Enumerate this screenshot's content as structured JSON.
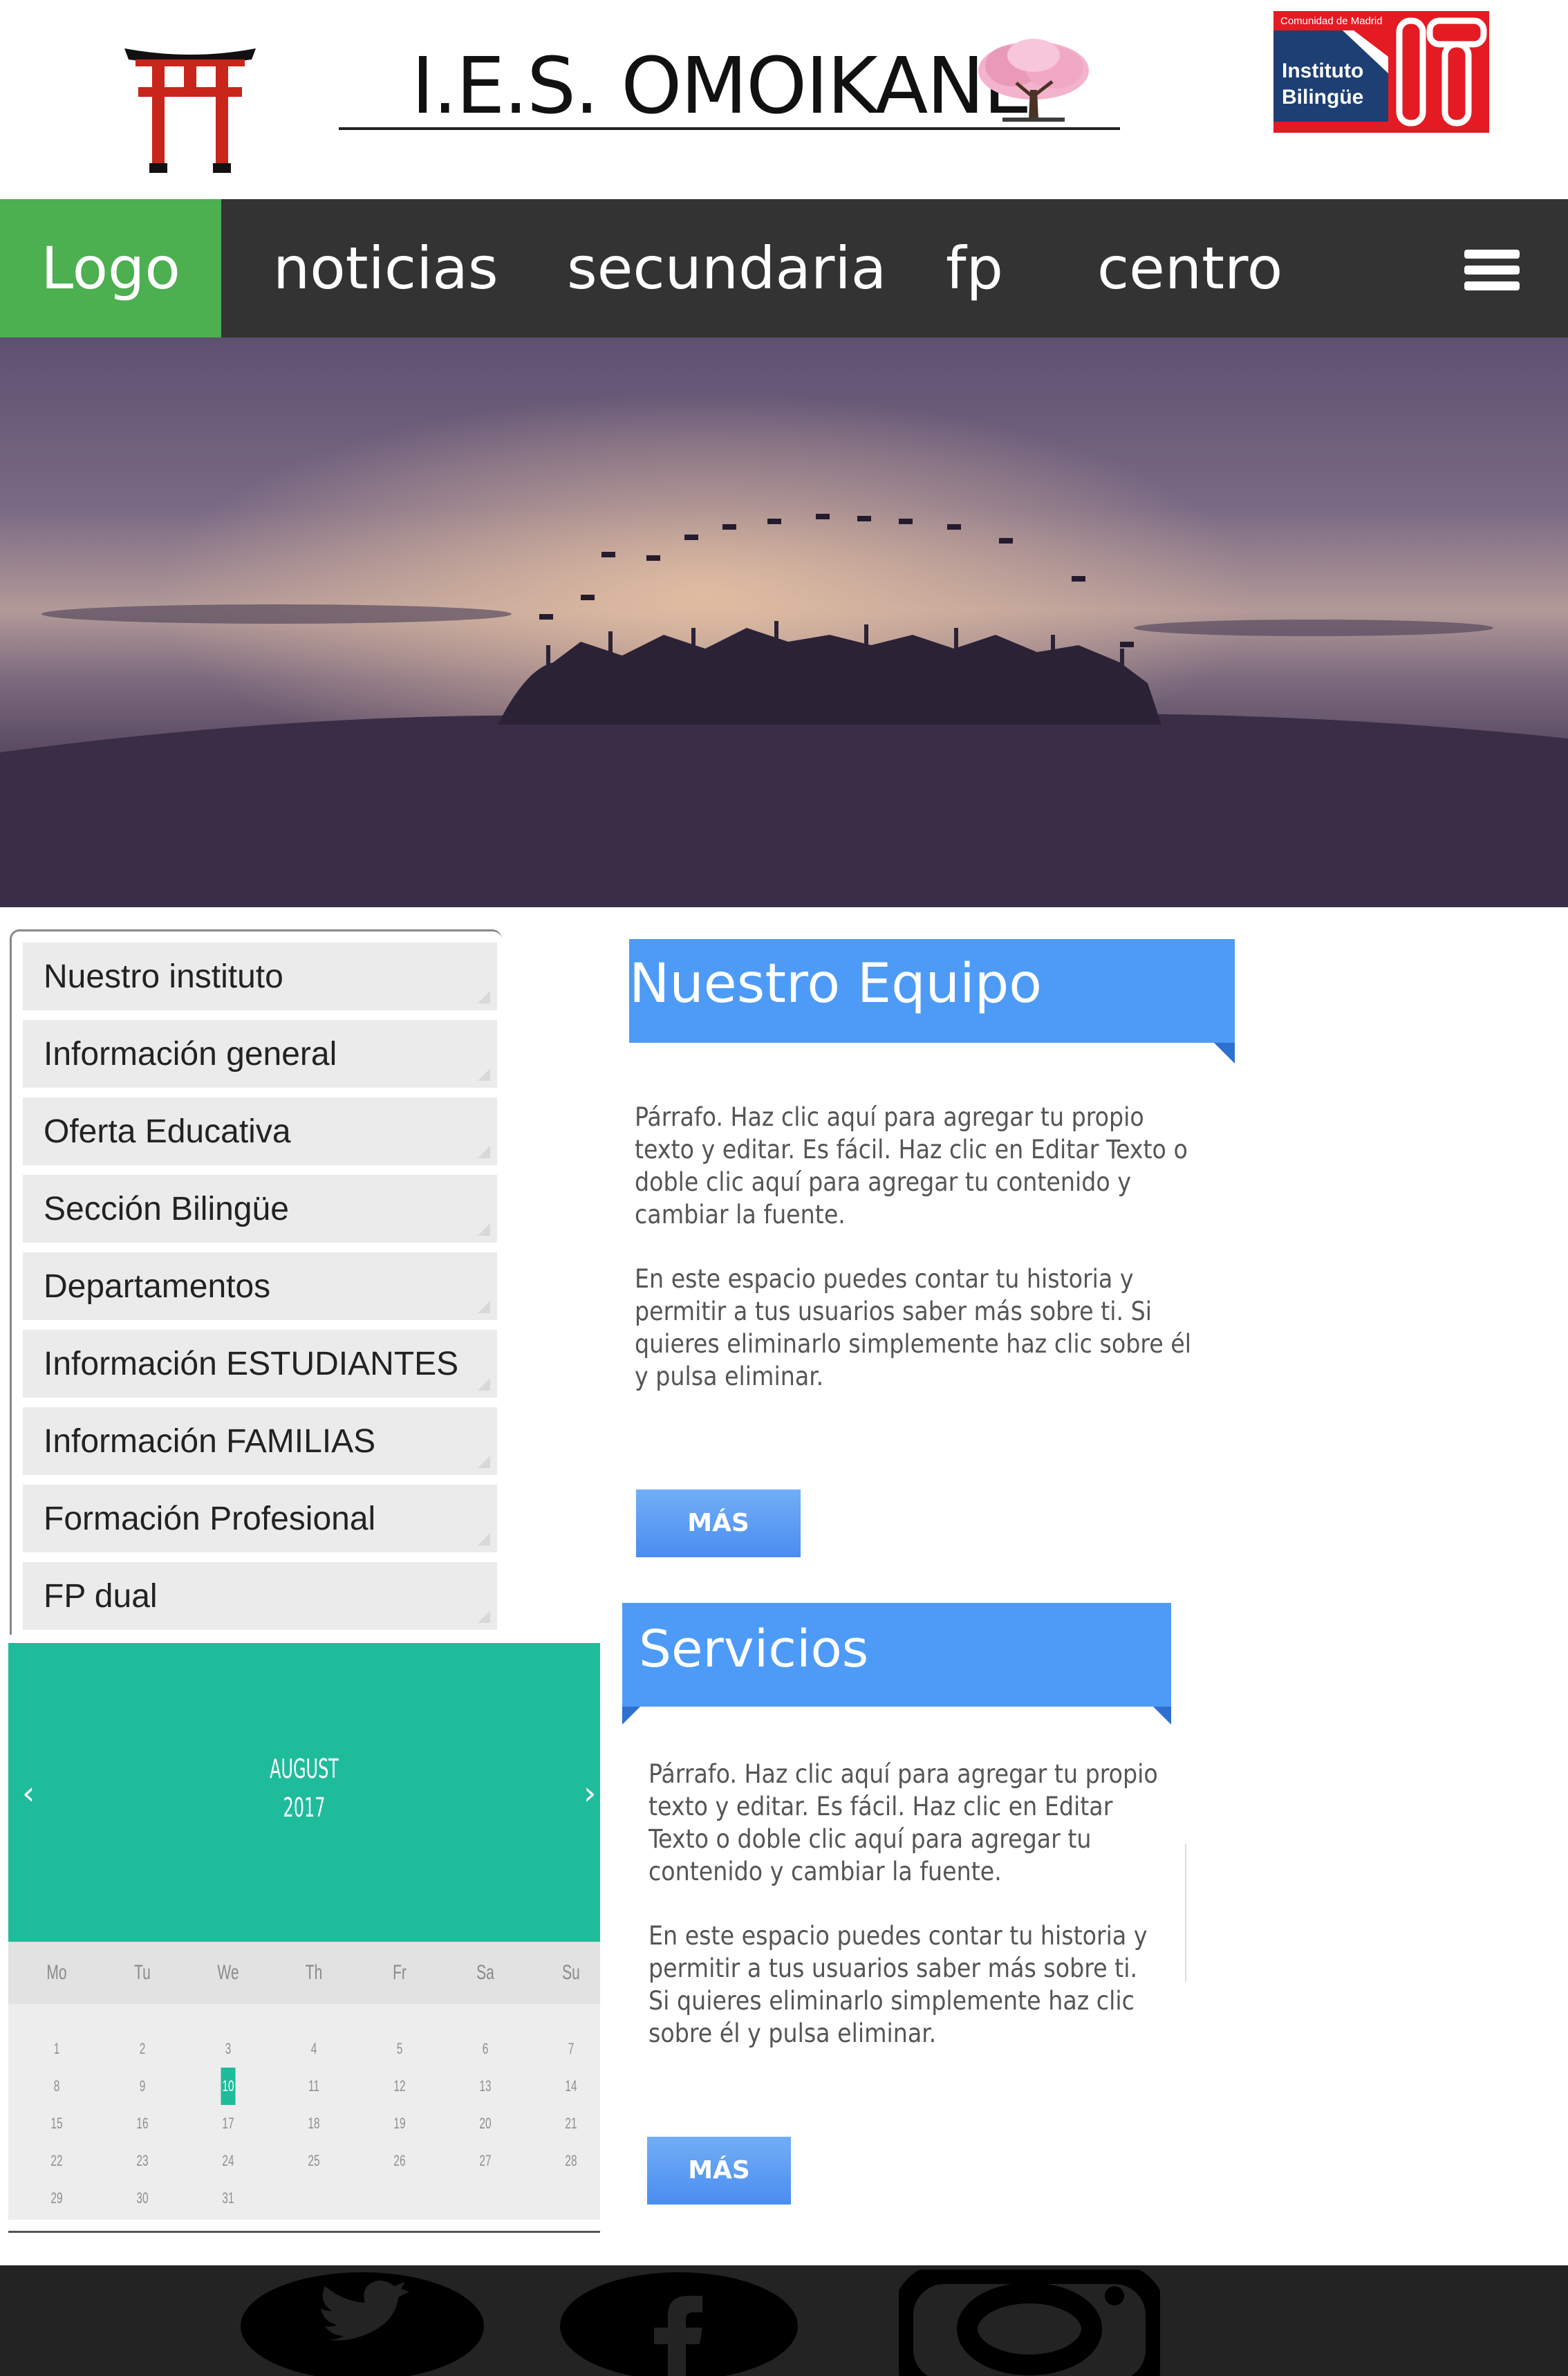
{
  "header": {
    "site_title": "I.E.S. OMOIKANE",
    "bilingue_logo": {
      "small_text": "Comunidad de Madrid",
      "line1": "Instituto",
      "line2": "Bilingüe",
      "big_letters": "IT",
      "colors": {
        "navy": "#1d3f73",
        "red": "#e41b23"
      }
    }
  },
  "nav": {
    "logo_label": "Logo",
    "items": [
      "noticias",
      "secundaria",
      "fp",
      "centro"
    ],
    "menu_icon": "hamburger-icon",
    "colors": {
      "bar": "#333333",
      "logo_bg": "#4CAF50"
    }
  },
  "hero": {
    "alt": "graduation silhouettes at sunset"
  },
  "sidebar": {
    "items": [
      "Nuestro instituto",
      "Información general",
      "Oferta Educativa",
      "Sección Bilingüe",
      "Departamentos",
      "Información ESTUDIANTES",
      "Información FAMILIAS",
      "Formación Profesional",
      "FP dual"
    ]
  },
  "calendar": {
    "month": "AUGUST",
    "year": "2017",
    "prev": "‹",
    "next": "›",
    "weekdays": [
      "Mo",
      "Tu",
      "We",
      "Th",
      "Fr",
      "Sa",
      "Su"
    ],
    "days_in_month": 31,
    "first_weekday_index": 0,
    "today": 10,
    "accent": "#1fbc9c"
  },
  "sections": [
    {
      "title": "Nuestro Equipo",
      "paragraph1": "Párrafo. Haz clic aquí para agregar tu propio texto y editar. Es fácil. Haz clic en Editar Texto o doble clic aquí para agregar tu contenido y cambiar la fuente.",
      "paragraph2": "En este espacio puedes contar tu historia y permitir a tus usuarios saber más sobre ti. Si quieres eliminarlo simplemente haz clic sobre él y pulsa eliminar.",
      "button": "MÁS"
    },
    {
      "title": "Servicios",
      "paragraph1": "Párrafo. Haz clic aquí para agregar tu propio texto y editar. Es fácil. Haz clic en Editar Texto o doble clic aquí para agregar tu contenido y cambiar la fuente.",
      "paragraph2": "En este espacio puedes contar tu historia y permitir a tus usuarios saber más sobre ti. Si quieres eliminarlo simplemente haz clic sobre él y pulsa eliminar.",
      "button": "MÁS"
    }
  ],
  "footer": {
    "social_icons": [
      "twitter-icon",
      "facebook-icon",
      "instagram-icon"
    ]
  },
  "colors": {
    "ribbon_blue": "#4d9bf7"
  }
}
